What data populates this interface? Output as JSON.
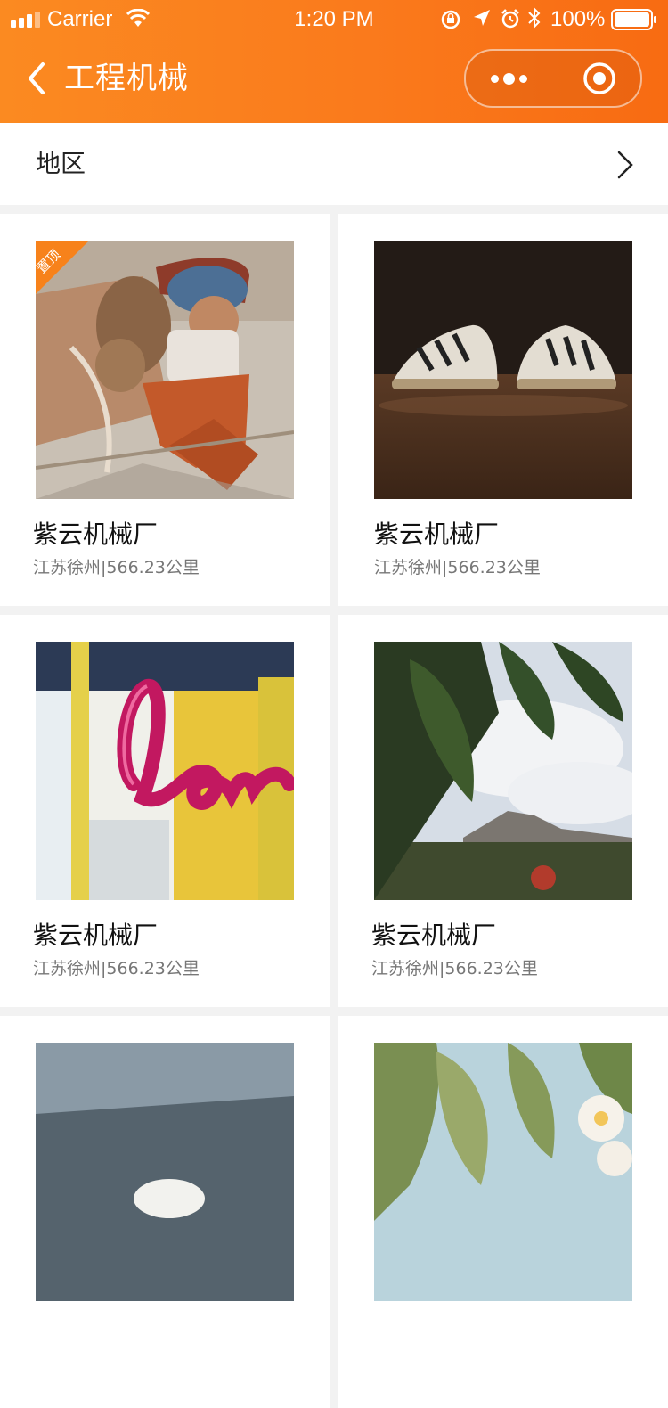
{
  "status_bar": {
    "carrier": "Carrier",
    "time": "1:20 PM",
    "battery": "100%"
  },
  "nav": {
    "title": "工程机械"
  },
  "filter": {
    "region_label": "地区"
  },
  "colors": {
    "header_orange": "#fa7a1c",
    "badge_orange": "#f7821b"
  },
  "cards": [
    {
      "name": "紫云机械厂",
      "location": "江苏徐州|566.23公里",
      "badge": "置顶",
      "image": "camel-and-woman-photo"
    },
    {
      "name": "紫云机械厂",
      "location": "江苏徐州|566.23公里",
      "image": "sneakers-photo"
    },
    {
      "name": "紫云机械厂",
      "location": "江苏徐州|566.23公里",
      "image": "love-balloon-photo"
    },
    {
      "name": "紫云机械厂",
      "location": "江苏徐州|566.23公里",
      "image": "mountain-leaves-photo"
    },
    {
      "name": "",
      "location": "",
      "image": "golf-ball-photo"
    },
    {
      "name": "",
      "location": "",
      "image": "plumeria-flowers-photo"
    }
  ]
}
